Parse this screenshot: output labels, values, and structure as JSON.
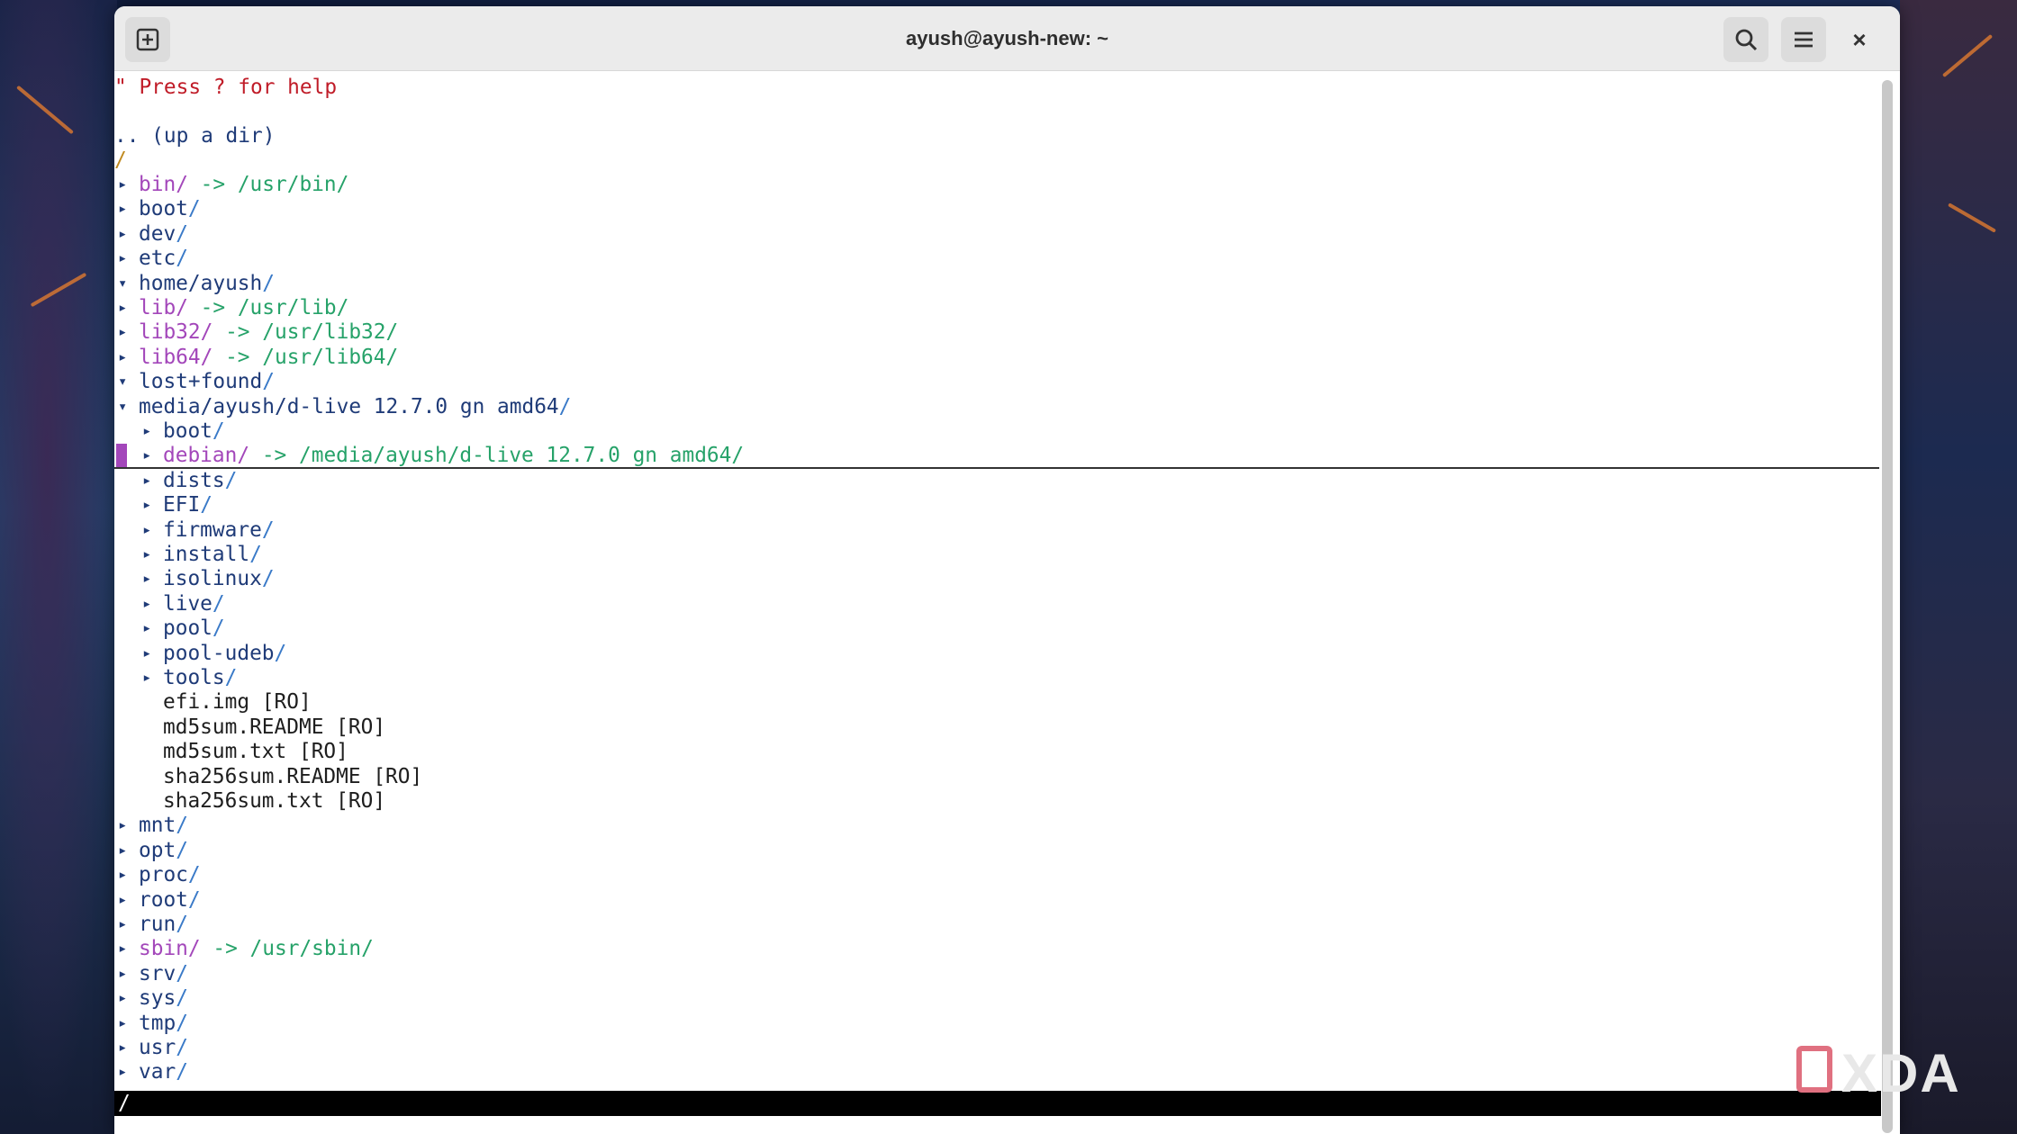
{
  "window": {
    "title": "ayush@ayush-new: ~"
  },
  "toolbar": {
    "new_tab_icon": "new-tab-icon",
    "search_icon": "search-icon",
    "menu_icon": "hamburger-menu-icon",
    "close_glyph": "×"
  },
  "terminal": {
    "help_line": "\" Press ? for help",
    "up_dir": ".. (up a dir)",
    "root_path": "/",
    "entries": [
      {
        "indent": 0,
        "arrow": "▸",
        "name": "bin",
        "link": "-> /usr/bin/"
      },
      {
        "indent": 0,
        "arrow": "▸",
        "name": "boot",
        "link": ""
      },
      {
        "indent": 0,
        "arrow": "▸",
        "name": "dev",
        "link": ""
      },
      {
        "indent": 0,
        "arrow": "▸",
        "name": "etc",
        "link": ""
      },
      {
        "indent": 0,
        "arrow": "▾",
        "name": "home/ayush",
        "link": ""
      },
      {
        "indent": 0,
        "arrow": "▸",
        "name": "lib",
        "link": "-> /usr/lib/"
      },
      {
        "indent": 0,
        "arrow": "▸",
        "name": "lib32",
        "link": "-> /usr/lib32/"
      },
      {
        "indent": 0,
        "arrow": "▸",
        "name": "lib64",
        "link": "-> /usr/lib64/"
      },
      {
        "indent": 0,
        "arrow": "▾",
        "name": "lost+found",
        "link": ""
      },
      {
        "indent": 0,
        "arrow": "▾",
        "name": "media/ayush/d-live 12.7.0 gn amd64",
        "link": ""
      },
      {
        "indent": 1,
        "arrow": "▸",
        "name": "boot",
        "link": ""
      },
      {
        "indent": 1,
        "arrow": "▸",
        "name": "debian",
        "link": "-> /media/ayush/d-live 12.7.0 gn amd64/",
        "selected": true
      },
      {
        "indent": 1,
        "arrow": "▸",
        "name": "dists",
        "link": ""
      },
      {
        "indent": 1,
        "arrow": "▸",
        "name": "EFI",
        "link": ""
      },
      {
        "indent": 1,
        "arrow": "▸",
        "name": "firmware",
        "link": ""
      },
      {
        "indent": 1,
        "arrow": "▸",
        "name": "install",
        "link": ""
      },
      {
        "indent": 1,
        "arrow": "▸",
        "name": "isolinux",
        "link": ""
      },
      {
        "indent": 1,
        "arrow": "▸",
        "name": "live",
        "link": ""
      },
      {
        "indent": 1,
        "arrow": "▸",
        "name": "pool",
        "link": ""
      },
      {
        "indent": 1,
        "arrow": "▸",
        "name": "pool-udeb",
        "link": ""
      },
      {
        "indent": 1,
        "arrow": "▸",
        "name": "tools",
        "link": ""
      },
      {
        "indent": 1,
        "arrow": "",
        "name": "efi.img [RO]",
        "link": "",
        "file": true
      },
      {
        "indent": 1,
        "arrow": "",
        "name": "md5sum.README [RO]",
        "link": "",
        "file": true
      },
      {
        "indent": 1,
        "arrow": "",
        "name": "md5sum.txt [RO]",
        "link": "",
        "file": true
      },
      {
        "indent": 1,
        "arrow": "",
        "name": "sha256sum.README [RO]",
        "link": "",
        "file": true
      },
      {
        "indent": 1,
        "arrow": "",
        "name": "sha256sum.txt [RO]",
        "link": "",
        "file": true
      },
      {
        "indent": 0,
        "arrow": "▸",
        "name": "mnt",
        "link": ""
      },
      {
        "indent": 0,
        "arrow": "▸",
        "name": "opt",
        "link": ""
      },
      {
        "indent": 0,
        "arrow": "▸",
        "name": "proc",
        "link": ""
      },
      {
        "indent": 0,
        "arrow": "▸",
        "name": "root",
        "link": ""
      },
      {
        "indent": 0,
        "arrow": "▸",
        "name": "run",
        "link": ""
      },
      {
        "indent": 0,
        "arrow": "▸",
        "name": "sbin",
        "link": "-> /usr/sbin/"
      },
      {
        "indent": 0,
        "arrow": "▸",
        "name": "srv",
        "link": ""
      },
      {
        "indent": 0,
        "arrow": "▸",
        "name": "sys",
        "link": ""
      },
      {
        "indent": 0,
        "arrow": "▸",
        "name": "tmp",
        "link": ""
      },
      {
        "indent": 0,
        "arrow": "▸",
        "name": "usr",
        "link": ""
      },
      {
        "indent": 0,
        "arrow": "▸",
        "name": "var",
        "link": ""
      }
    ],
    "status_line": "/"
  },
  "watermark": {
    "text": "XDA"
  },
  "colors": {
    "help_text": "#c01c28",
    "dir_text": "#1f3b78",
    "link_text": "#26a269",
    "symlink_name": "#a347ba",
    "cursor": "#a347ba"
  }
}
